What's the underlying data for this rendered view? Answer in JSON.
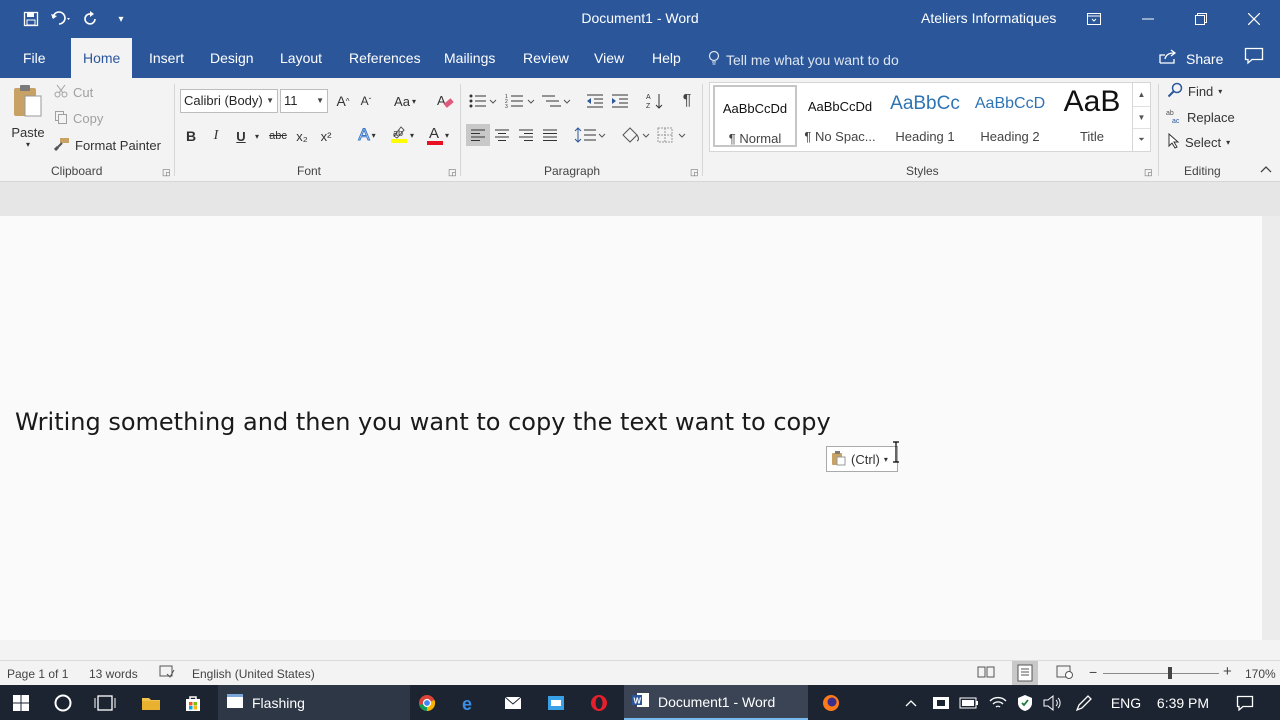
{
  "titlebar": {
    "doc_title": "Document1 - Word",
    "account": "Ateliers Informatiques",
    "qat_customize": "▾"
  },
  "tabs": {
    "file": "File",
    "home": "Home",
    "insert": "Insert",
    "design": "Design",
    "layout": "Layout",
    "references": "References",
    "mailings": "Mailings",
    "review": "Review",
    "view": "View",
    "help": "Help",
    "tell_me": "Tell me what you want to do",
    "share": "Share"
  },
  "clipboard": {
    "paste": "Paste",
    "cut": "Cut",
    "copy": "Copy",
    "format_painter": "Format Painter",
    "label": "Clipboard"
  },
  "font": {
    "name": "Calibri (Body)",
    "size": "11",
    "label": "Font",
    "change_case": "Aa",
    "grow": "A",
    "shrink": "A",
    "bold": "B",
    "italic": "I",
    "underline": "U",
    "strikethrough": "abc",
    "subscript": "x₂",
    "superscript": "x²",
    "text_effects": "A",
    "font_color": "A",
    "highlight_color": "#ffff00",
    "font_color_value": "#e81123"
  },
  "paragraph": {
    "label": "Paragraph",
    "pilcrow": "¶"
  },
  "styles": {
    "label": "Styles",
    "items": [
      {
        "preview": "AaBbCcDd",
        "name": "¶ Normal"
      },
      {
        "preview": "AaBbCcDd",
        "name": "¶ No Spac..."
      },
      {
        "preview": "AaBbCc",
        "name": "Heading 1"
      },
      {
        "preview": "AaBbCcD",
        "name": "Heading 2"
      },
      {
        "preview": "AaB",
        "name": "Title"
      }
    ]
  },
  "editing": {
    "find": "Find",
    "replace": "Replace",
    "select": "Select",
    "label": "Editing"
  },
  "document": {
    "text": "Writing something and then you want to copy the text want to copy",
    "paste_options": "(Ctrl)"
  },
  "status": {
    "page": "Page 1 of 1",
    "words": "13 words",
    "language": "English (United States)",
    "zoom": "170%"
  },
  "taskbar": {
    "flashing_app": "Flashing",
    "word_app": "Document1 - Word",
    "language": "ENG",
    "time": "6:39 PM"
  },
  "colors": {
    "word_blue": "#2b579a",
    "taskbar": "#1c2431"
  }
}
